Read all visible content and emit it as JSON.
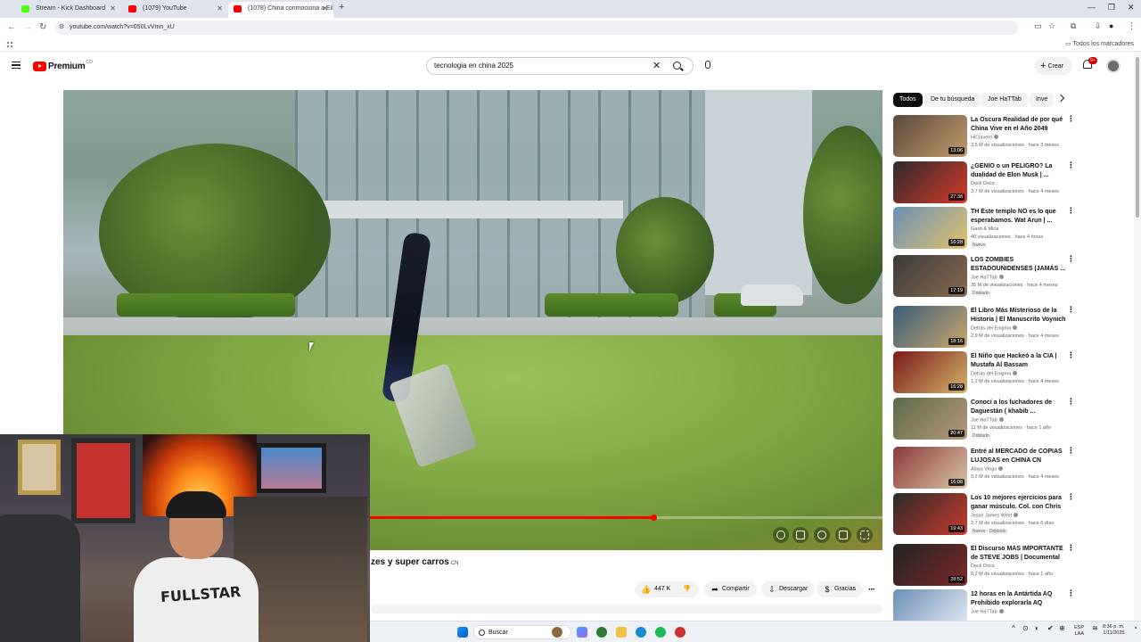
{
  "browser": {
    "tabs": [
      {
        "title": "Stream - Kick Dashboard",
        "favicon_color": "#53fc18",
        "active": false
      },
      {
        "title": "(1079) YouTube",
        "favicon_color": "#ff0000",
        "active": false
      },
      {
        "title": "(1078) China conmociona a Eil",
        "favicon_color": "#ff0000",
        "active": true
      }
    ],
    "url": "youtube.com/watch?v=050LvVmn_xU",
    "bookmarks_label": "Todos los marcadores"
  },
  "youtube": {
    "logo_text": "Premium",
    "logo_country": "CO",
    "search_query": "tecnologia en china 2025",
    "create_label": "Crear",
    "notifications_badge": "9+"
  },
  "video": {
    "title_visible": "zes y super carros",
    "title_flag": "CN",
    "progress_fraction": 0.72,
    "likes": "447 K",
    "actions": {
      "share": "Compartir",
      "download": "Descargar",
      "thanks": "Gracias"
    }
  },
  "webcam": {
    "shirt_text": "FULLSTAR"
  },
  "sidebar": {
    "chips": [
      "Todos",
      "De tu búsqueda",
      "Joe HaTTab",
      "Inve"
    ],
    "recommendations": [
      {
        "title": "La Oscura Realidad de por qué China Vive en el Año 2049",
        "channel": "HiClavero",
        "verified": true,
        "meta": "3,5 M de visualizaciones · hace 3 meses",
        "duration": "13:06",
        "badge": "",
        "thumb": [
          "#5a4a3a",
          "#c49a6c"
        ]
      },
      {
        "title": "¿GENIO o un PELIGRO? La dualidad de Elon Musk | ...",
        "channel": "Deck Docs",
        "verified": false,
        "meta": "3,7 M de visualizaciones · hace 4 meses",
        "duration": "27:38",
        "badge": "",
        "thumb": [
          "#2b2b2b",
          "#d63a2a"
        ]
      },
      {
        "title": "TH Este templo NO es lo que esperabamos. Wat Arun | ...",
        "channel": "Gasti & Mica",
        "verified": false,
        "meta": "40 visualizaciones · hace 4 horas",
        "duration": "16:28",
        "badge": "Nuevo",
        "thumb": [
          "#6b8fb5",
          "#e0c36a"
        ]
      },
      {
        "title": "LOS ZOMBIES ESTADOUNIDENSES (JAMÁS ...",
        "channel": "Joe HaTTab",
        "verified": true,
        "meta": "35 M de visualizaciones · hace 4 meses",
        "duration": "17:19",
        "badge": "Doblado",
        "thumb": [
          "#3a3a3a",
          "#8a6a50"
        ]
      },
      {
        "title": "El Libro Más Misterioso de la Historia | El Manuscrito Voynich",
        "channel": "Detrás del Enigma",
        "verified": true,
        "meta": "2,9 M de visualizaciones · hace 4 meses",
        "duration": "18:16",
        "badge": "",
        "thumb": [
          "#3b5f7a",
          "#c9a46a"
        ]
      },
      {
        "title": "El Niño que Hackeó a la CIA | Mustafa Al Bassam",
        "channel": "Detrás del Enigma",
        "verified": true,
        "meta": "1,2 M de visualizaciones · hace 4 meses",
        "duration": "16:28",
        "badge": "",
        "thumb": [
          "#7a1a1a",
          "#d2b36a"
        ]
      },
      {
        "title": "Conocí a los luchadores de Daguestán ( khabib ...",
        "channel": "Joe HaTTab",
        "verified": true,
        "meta": "11 M de visualizaciones · hace 1 año",
        "duration": "20:47",
        "badge": "Doblado",
        "thumb": [
          "#5b6b4a",
          "#b8987a"
        ]
      },
      {
        "title": "Entré al MERCADO de COPIAS LUJOSAS en CHINA CN",
        "channel": "Alaya Vlogs",
        "verified": true,
        "meta": "3,2 M de visualizaciones · hace 4 meses",
        "duration": "16:08",
        "badge": "",
        "thumb": [
          "#8a3a3a",
          "#d9c4a4"
        ]
      },
      {
        "title": "Los 10 mejores ejercicios para ganar músculo. Col. con Chris ...",
        "channel": "Jesse James West",
        "verified": true,
        "meta": "2,7 M de visualizaciones · hace 6 días",
        "duration": "19:43",
        "badge": "Nuevo · Doblado",
        "thumb": [
          "#2a2a2a",
          "#c93a2a"
        ]
      },
      {
        "title": "El Discurso MÁS IMPORTANTE de STEVE JOBS | Documental",
        "channel": "Deck Docs",
        "verified": false,
        "meta": "9,2 M de visualizaciones · hace 1 año",
        "duration": "28:52",
        "badge": "",
        "thumb": [
          "#222222",
          "#7a2a2a"
        ]
      },
      {
        "title": "12 horas en la Antártida AQ Prohibido explorarla AQ",
        "channel": "Joe HaTTab",
        "verified": true,
        "meta": "",
        "duration": "",
        "badge": "",
        "thumb": [
          "#6a8fb5",
          "#e8eef5"
        ]
      }
    ]
  },
  "taskbar": {
    "search_label": "Buscar",
    "lang": "ESP\nLAA",
    "time": "8:36 p. m.",
    "date": "1/11/2025"
  }
}
